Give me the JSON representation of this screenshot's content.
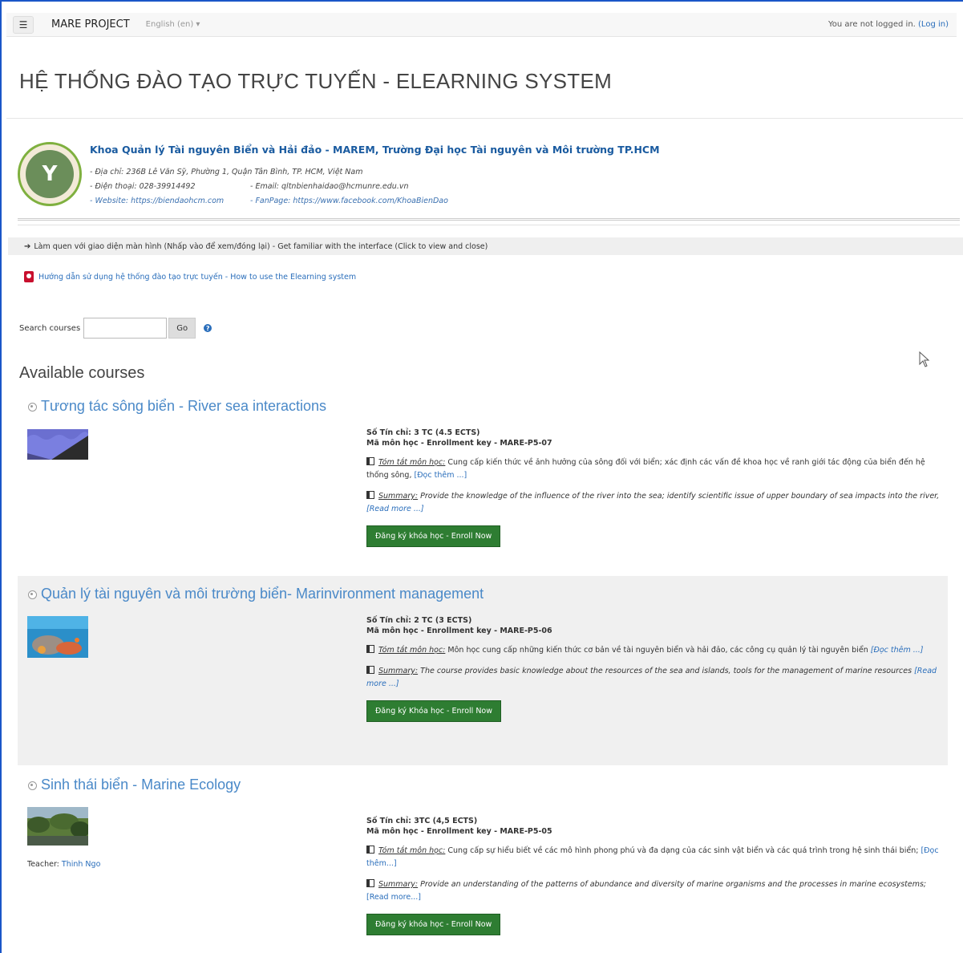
{
  "navbar": {
    "menu_icon": "hamburger-icon",
    "brand": "MARE PROJECT",
    "language": "English (en) ▾",
    "login_text": "You are not logged in. ",
    "login_link": "(Log in)"
  },
  "header": {
    "title": "HỆ THỐNG ĐÀO TẠO TRỰC TUYẾN - ELEARNING SYSTEM"
  },
  "institution": {
    "name": "Khoa Quản lý Tài nguyên Biển và Hải đảo - MAREM, Trường Đại học Tài nguyên và Môi trường TP.HCM",
    "address": "- Địa chỉ: 236B Lê Văn Sỹ, Phường 1, Quận Tân Bình, TP. HCM, Việt Nam",
    "phone": "- Điện thoại: 028-39914492",
    "email": "- Email: qltnbienhaidao@hcmunre.edu.vn",
    "website": "- Website: https://biendaohcm.com",
    "fanpage": "- FanPage: https://www.facebook.com/KhoaBienDao"
  },
  "familiar": {
    "text": "Làm quen với giao diện màn hình (Nhấp vào để xem/đóng lại) - Get familiar with the interface (Click to view and close)"
  },
  "guide": {
    "text": "Hướng dẫn sử dụng hệ thống đào tạo trực tuyến - How to use the Elearning system"
  },
  "search": {
    "label": "Search courses",
    "value": "",
    "go": "Go",
    "help": "?"
  },
  "available_title": "Available courses",
  "courses": [
    {
      "title": "Tương tác sông biển - River sea interactions",
      "credits": "Số Tín chỉ: 3 TC (4.5 ECTS)",
      "key": "Mã môn học - Enrollment key - MARE-P5-07",
      "summary_vi_label": "Tóm tắt môn học:",
      "summary_vi": " Cung cấp kiến thức về ảnh hưởng của sông đối với biển; xác định các vấn đề khoa học về ranh giới tác động của biển đến hệ thống sông, ",
      "more_vi": "[Đọc thêm ...]",
      "summary_en_label": "Summary:",
      "summary_en": " Provide the knowledge of the influence of the river into the sea; identify scientific issue of upper boundary of sea impacts into the river, ",
      "more_en": " [Read more ...]",
      "enroll": "Đăng ký khóa học - Enroll Now"
    },
    {
      "title": "Quản lý tài nguyên và môi trường biển- Marinvironment management",
      "credits": "Số Tín chỉ: 2 TC (3 ECTS)",
      "key": "Mã môn học - Enrollment key - MARE-P5-06",
      "summary_vi_label": "Tóm tắt môn học:",
      "summary_vi": " Môn học cung cấp những kiến thức cơ bản về tài nguyên biển và hải đảo, các công cụ quản lý tài nguyên biển ",
      "more_vi": "[Đọc thêm ...]",
      "summary_en_label": "Summary:",
      "summary_en": " The course provides basic knowledge about the resources of the sea and islands, tools for the management of marine resources ",
      "more_en": "[Read more ...]",
      "enroll": "Đăng ký Khóa học - Enroll Now"
    },
    {
      "title": "Sinh thái biển - Marine Ecology",
      "teacher_label": "Teacher: ",
      "teacher": "Thinh Ngo",
      "credits": "Số Tín chỉ: 3TC (4,5 ECTS)",
      "key": "Mã môn học - Enrollment key - MARE-P5-05",
      "summary_vi_label": "Tóm tắt môn học:",
      "summary_vi": " Cung cấp sự hiểu biết về các mô hình phong phú và đa dạng của các sinh vật biển và các quá trình trong hệ sinh thái biển; ",
      "more_vi": "[Đọc thêm...]",
      "summary_en_label": "Summary:",
      "summary_en": " Provide an understanding of the patterns of abundance and diversity of marine organisms and the processes in marine ecosystems; ",
      "more_en": "[Read more...]",
      "enroll": "Đăng ký khóa học - Enroll Now"
    }
  ]
}
